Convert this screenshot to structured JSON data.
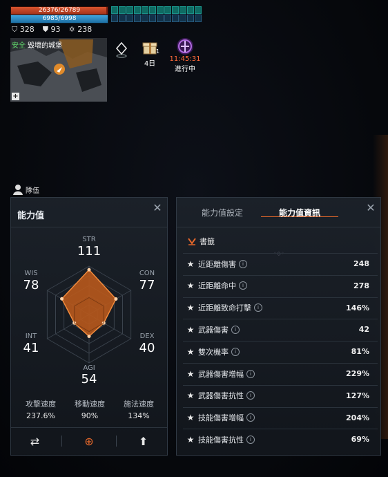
{
  "hud": {
    "hp_text": "26376/26789",
    "hp_fraction": 0.985,
    "mp_text": "6985/6998",
    "mp_fraction": 0.998,
    "stats": [
      {
        "icon": "shield-icon",
        "glyph": "⛉",
        "value": "328"
      },
      {
        "icon": "shield-alt-icon",
        "glyph": "⛊",
        "value": "93"
      },
      {
        "icon": "star-of-david-icon",
        "glyph": "✡",
        "value": "238"
      }
    ],
    "minimap": {
      "safe_label": "安全",
      "zone_name": "毀壞的城堡",
      "expand_label": "+"
    },
    "gift_badge": "1",
    "gift_days": "4日",
    "event_time": "11:45:31",
    "event_status": "進行中",
    "party_label": "隊伍"
  },
  "stats_panel": {
    "title": "能力值",
    "radar": {
      "STR": {
        "label": "STR",
        "value": "111",
        "raw": 111
      },
      "CON": {
        "label": "CON",
        "value": "77",
        "raw": 77
      },
      "DEX": {
        "label": "DEX",
        "value": "40",
        "raw": 40
      },
      "AGI": {
        "label": "AGI",
        "value": "54",
        "raw": 54
      },
      "INT": {
        "label": "INT",
        "value": "41",
        "raw": 41
      },
      "WIS": {
        "label": "WIS",
        "value": "78",
        "raw": 78
      }
    },
    "speeds": [
      {
        "label": "攻擊速度",
        "value": "237.6%"
      },
      {
        "label": "移動速度",
        "value": "90%"
      },
      {
        "label": "施法速度",
        "value": "134%"
      }
    ],
    "buttons": [
      {
        "icon": "swap-icon",
        "glyph": "⇄"
      },
      {
        "icon": "zoom-in-icon",
        "glyph": "⊕"
      },
      {
        "icon": "arrow-up-icon",
        "glyph": "⬆"
      }
    ]
  },
  "info_panel": {
    "tabs": [
      "能力值設定",
      "能力值資訊"
    ],
    "active_tab": 1,
    "bookmark_label": "書籤",
    "rows": [
      {
        "label": "近距離傷害",
        "value": "248"
      },
      {
        "label": "近距離命中",
        "value": "278"
      },
      {
        "label": "近距離致命打擊",
        "value": "146%"
      },
      {
        "label": "武器傷害",
        "value": "42"
      },
      {
        "label": "雙次機率",
        "value": "81%"
      },
      {
        "label": "武器傷害增幅",
        "value": "229%"
      },
      {
        "label": "武器傷害抗性",
        "value": "127%"
      },
      {
        "label": "技能傷害增幅",
        "value": "204%"
      },
      {
        "label": "技能傷害抗性",
        "value": "69%"
      }
    ]
  },
  "colors": {
    "accent": "#e4672a",
    "radar_fill": "#b8591c",
    "hp": "#c2401f",
    "mp": "#2b86c2"
  }
}
